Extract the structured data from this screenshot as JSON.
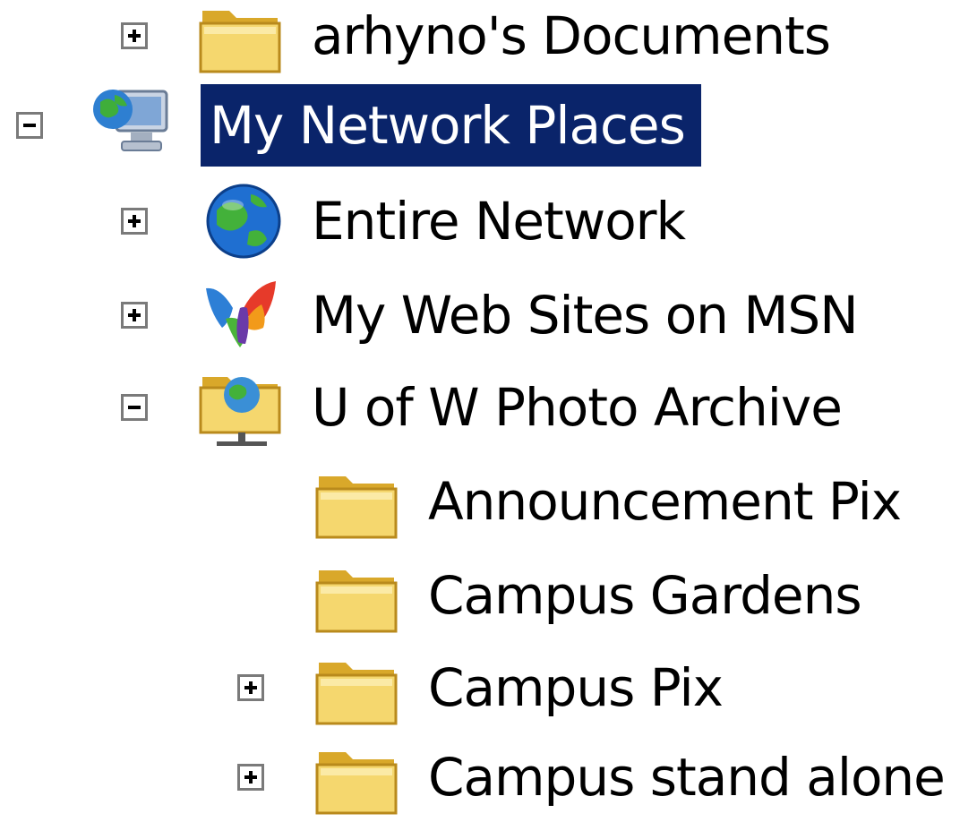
{
  "tree": {
    "items": [
      {
        "label": "arhyno's Documents",
        "icon": "folder-icon",
        "expander": "plus",
        "selected": false
      },
      {
        "label": "My Network Places",
        "icon": "network-places-icon",
        "expander": "minus",
        "selected": true
      },
      {
        "label": "Entire Network",
        "icon": "globe-icon",
        "expander": "plus",
        "selected": false
      },
      {
        "label": "My Web Sites on MSN",
        "icon": "msn-butterfly-icon",
        "expander": "plus",
        "selected": false
      },
      {
        "label": "U of W Photo Archive",
        "icon": "network-folder-icon",
        "expander": "minus",
        "selected": false
      },
      {
        "label": "Announcement Pix",
        "icon": "folder-icon",
        "expander": "none",
        "selected": false
      },
      {
        "label": "Campus Gardens",
        "icon": "folder-icon",
        "expander": "none",
        "selected": false
      },
      {
        "label": "Campus Pix",
        "icon": "folder-icon",
        "expander": "plus",
        "selected": false
      },
      {
        "label": "Campus stand alone",
        "icon": "folder-icon",
        "expander": "plus",
        "selected": false
      }
    ]
  },
  "colors": {
    "selection_bg": "#0a246a",
    "selection_text": "#ffffff",
    "folder_yellow": "#f5d76e",
    "expander_border": "#7a7a7a"
  }
}
